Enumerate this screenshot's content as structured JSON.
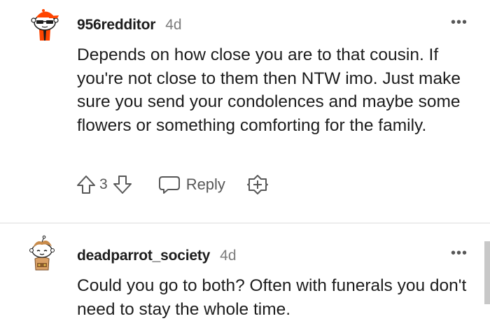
{
  "comments": [
    {
      "username": "956redditor",
      "timestamp": "4d",
      "body": "Depends on how close you are to that cousin. If you're not close to them then NTW imo. Just make sure you send your condolences and maybe some flowers or something comforting for the family.",
      "vote_count": "3",
      "reply_label": "Reply",
      "more_label": "•••",
      "avatar_icon": "snoo-avatar-sunglasses-icon"
    },
    {
      "username": "deadparrot_society",
      "timestamp": "4d",
      "body": "Could you go to both? Often with funerals you don't need to stay the whole time.",
      "more_label": "•••",
      "avatar_icon": "snoo-avatar-explorer-icon"
    }
  ],
  "colors": {
    "text": "#1c1c1c",
    "muted": "#7c7c7c",
    "icon": "#575757",
    "avatar_orange": "#ff4500",
    "divider": "#ededed"
  }
}
